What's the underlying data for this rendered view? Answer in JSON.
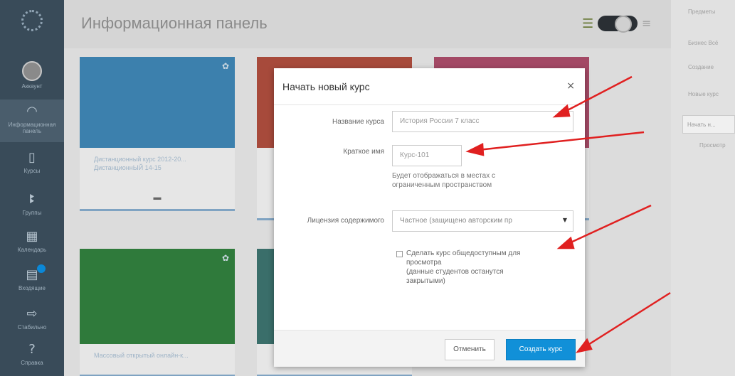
{
  "header": {
    "title": "Информационная панель"
  },
  "sidebar": {
    "items": [
      {
        "label": "Аккаунт",
        "icon": "user-avatar"
      },
      {
        "label": "Информационная панель",
        "icon": "dashboard-icon"
      },
      {
        "label": "Курсы",
        "icon": "book-icon"
      },
      {
        "label": "Группы",
        "icon": "users-icon"
      },
      {
        "label": "Календарь",
        "icon": "calendar-icon"
      },
      {
        "label": "Входящие",
        "icon": "inbox-icon"
      },
      {
        "label": "Стабильно",
        "icon": "arrow-icon"
      },
      {
        "label": "Справка",
        "icon": "help-icon"
      }
    ]
  },
  "cards": [
    {
      "text": "Дистанционный курс 2012-20... ДистанционнЫЙ 14-15",
      "color": "#3c80ad"
    },
    {
      "text": "",
      "color": "#a74a3b"
    },
    {
      "text": "",
      "color": "#a34965"
    },
    {
      "text": "Массовый открытый онлайн-к...",
      "color": "#2f7a3b"
    },
    {
      "text": "",
      "color": "#3a6e6a"
    }
  ],
  "right_panel": {
    "lines": [
      "Предметы",
      "Бизнес Всё",
      "Создание",
      "Новые курс",
      "Начать н...",
      "Просмотр"
    ]
  },
  "modal": {
    "title": "Начать новый курс",
    "close_label": "×",
    "fields": {
      "course_name": {
        "label": "Название курса",
        "value": "История России 7 класс"
      },
      "short_name": {
        "label": "Краткое имя",
        "placeholder": "Курс-101",
        "help": "Будет отображаться в местах с ограниченным пространством"
      },
      "license": {
        "label": "Лицензия содержимого",
        "selected": "Частное (защищено авторским пр"
      },
      "public": {
        "label_line1": "Сделать курс общедоступным для",
        "label_line2": "просмотра",
        "label_line3": "(данные студентов останутся",
        "label_line4": "закрытыми)"
      }
    },
    "buttons": {
      "cancel": "Отменить",
      "create": "Создать курс"
    }
  },
  "colors": {
    "sidebar": "#394b59",
    "primary_button": "#1190d8",
    "annotation": "#e02020"
  }
}
